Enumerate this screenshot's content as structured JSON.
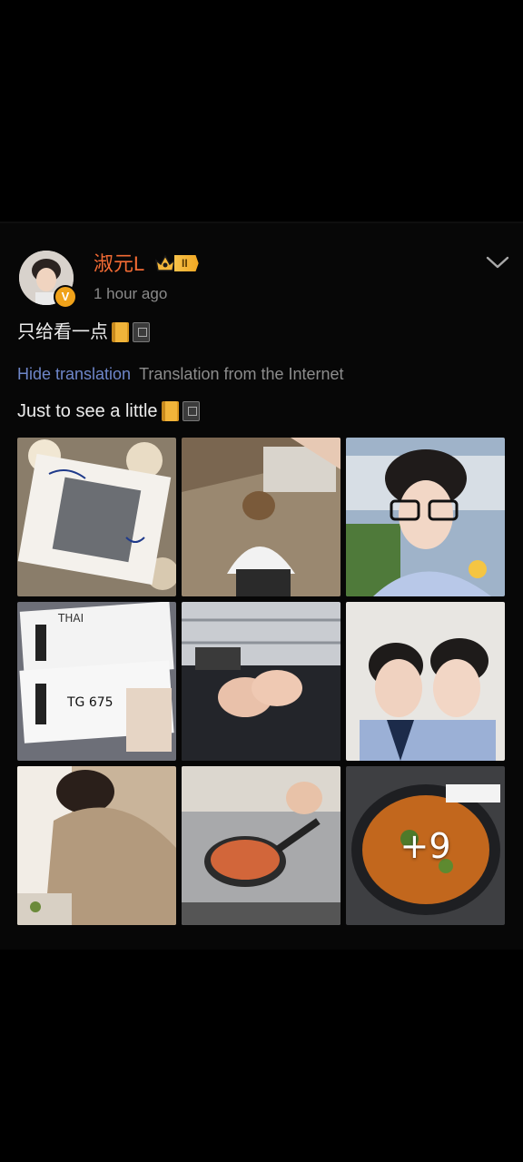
{
  "post": {
    "author": {
      "name": "淑元L",
      "level": "II",
      "verified_mark": "V",
      "time": "1 hour ago"
    },
    "text": "只给看一点",
    "translation": {
      "hide_label": "Hide translation",
      "source_label": "Translation from the Internet",
      "text": "Just to see a little"
    },
    "images": [
      {
        "alt": "signed polaroid with flowers",
        "icon": "photo"
      },
      {
        "alt": "person crouching on floor",
        "icon": "photo"
      },
      {
        "alt": "selfie with glasses",
        "icon": "photo"
      },
      {
        "alt": "THAI boarding passes",
        "icon": "photo",
        "flight": "TG 675",
        "brand": "THAI"
      },
      {
        "alt": "holding hands",
        "icon": "photo"
      },
      {
        "alt": "two people selfie",
        "icon": "photo"
      },
      {
        "alt": "person cooking at counter",
        "icon": "photo"
      },
      {
        "alt": "frying pan on stove",
        "icon": "photo"
      },
      {
        "alt": "curry in pan",
        "icon": "photo"
      }
    ],
    "more_count": "+9"
  },
  "colors": {
    "username": "#f36b34",
    "link": "#6e86c9",
    "muted": "#8a8a8a",
    "badge": "#f1a722"
  }
}
